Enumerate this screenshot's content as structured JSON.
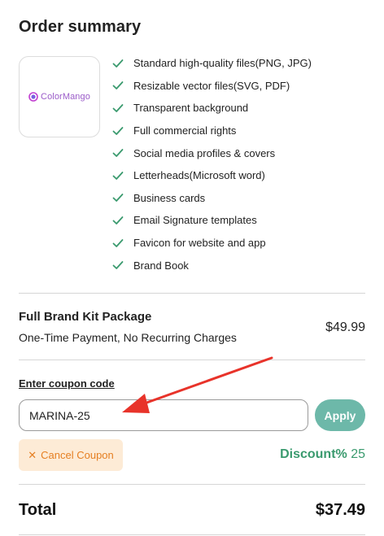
{
  "order_summary": {
    "title": "Order summary",
    "logo": {
      "text": "ColorMango",
      "icon": "colormango-logo-icon"
    },
    "features": [
      "Standard high-quality files(PNG, JPG)",
      "Resizable vector files(SVG, PDF)",
      "Transparent background",
      "Full commercial rights",
      "Social media profiles & covers",
      "Letterheads(Microsoft word)",
      "Business cards",
      "Email Signature templates",
      "Favicon for website and app",
      "Brand Book"
    ]
  },
  "package": {
    "name": "Full Brand Kit Package",
    "subtitle": "One-Time Payment, No Recurring Charges",
    "price": "$49.99"
  },
  "coupon": {
    "label": "Enter coupon code",
    "value": "MARINA-25",
    "apply_label": "Apply",
    "cancel_label": "Cancel Coupon",
    "cancel_icon": "close-icon",
    "discount_label": "Discount%",
    "discount_value": "25"
  },
  "total": {
    "label": "Total",
    "value": "$37.49"
  },
  "colors": {
    "check": "#3a9a6e",
    "apply_bg": "#6db8a9",
    "cancel_bg": "#fdebd6",
    "cancel_text": "#e57f22",
    "discount": "#3a9a6e",
    "annotation_arrow": "#e8332a"
  }
}
